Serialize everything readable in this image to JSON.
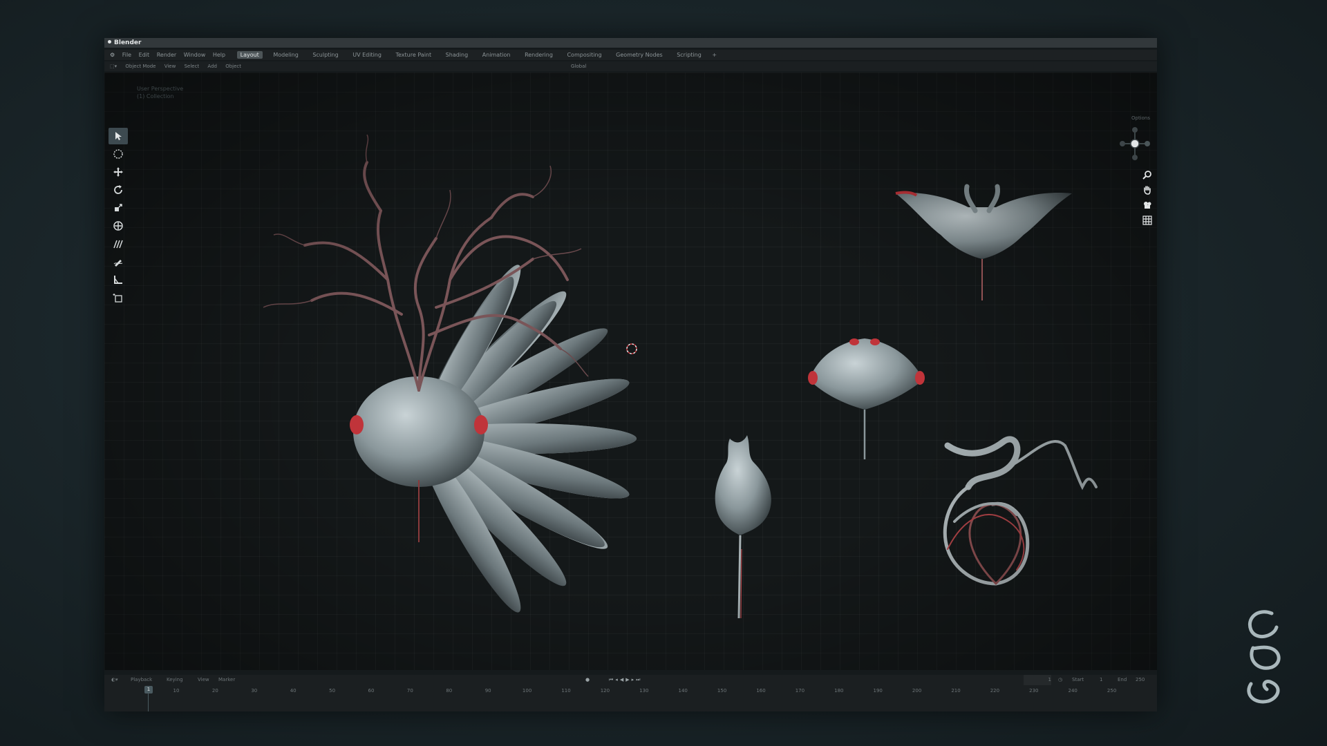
{
  "app": {
    "title": "Blender"
  },
  "menubar": {
    "items": [
      "File",
      "Edit",
      "Render",
      "Window",
      "Help"
    ],
    "workspaces": [
      "Layout",
      "Modeling",
      "Sculpting",
      "UV Editing",
      "Texture Paint",
      "Shading",
      "Animation",
      "Rendering",
      "Compositing",
      "Geometry Nodes",
      "Scripting"
    ],
    "active_workspace": "Layout",
    "add_tab": "+"
  },
  "header": {
    "mode": "Object Mode",
    "menus": [
      "View",
      "Select",
      "Add",
      "Object"
    ],
    "transform": "Global"
  },
  "viewport": {
    "info_lines": [
      "User Perspective",
      "(1) Collection"
    ],
    "options_label": "Options"
  },
  "toolbar": {
    "tools": [
      "select-cursor-icon",
      "circle-select-icon",
      "move-icon",
      "rotate-icon",
      "scale-icon",
      "transform-icon",
      "annotate-icon",
      "draw-icon",
      "measure-icon",
      "add-cube-icon"
    ],
    "active_index": 0
  },
  "nav": {
    "buttons": [
      "zoom-icon",
      "hand-pan-icon",
      "camera-icon",
      "grid-icon"
    ]
  },
  "timeline": {
    "menus": [
      "Playback",
      "Keying",
      "View",
      "Marker"
    ],
    "current_frame": "1",
    "start_label": "Start",
    "start_value": "1",
    "end_label": "End",
    "end_value": "250",
    "playhead_label": "1",
    "ticks": [
      "10",
      "20",
      "30",
      "40",
      "50",
      "60",
      "70",
      "80",
      "90",
      "100",
      "110",
      "120",
      "130",
      "140",
      "150",
      "160",
      "170",
      "180",
      "190",
      "200",
      "210",
      "220",
      "230",
      "240",
      "250"
    ]
  },
  "colors": {
    "accent": "#4d5558",
    "sculpt_red": "#c0343a",
    "sculpt_gray": "#9aa7ab"
  }
}
